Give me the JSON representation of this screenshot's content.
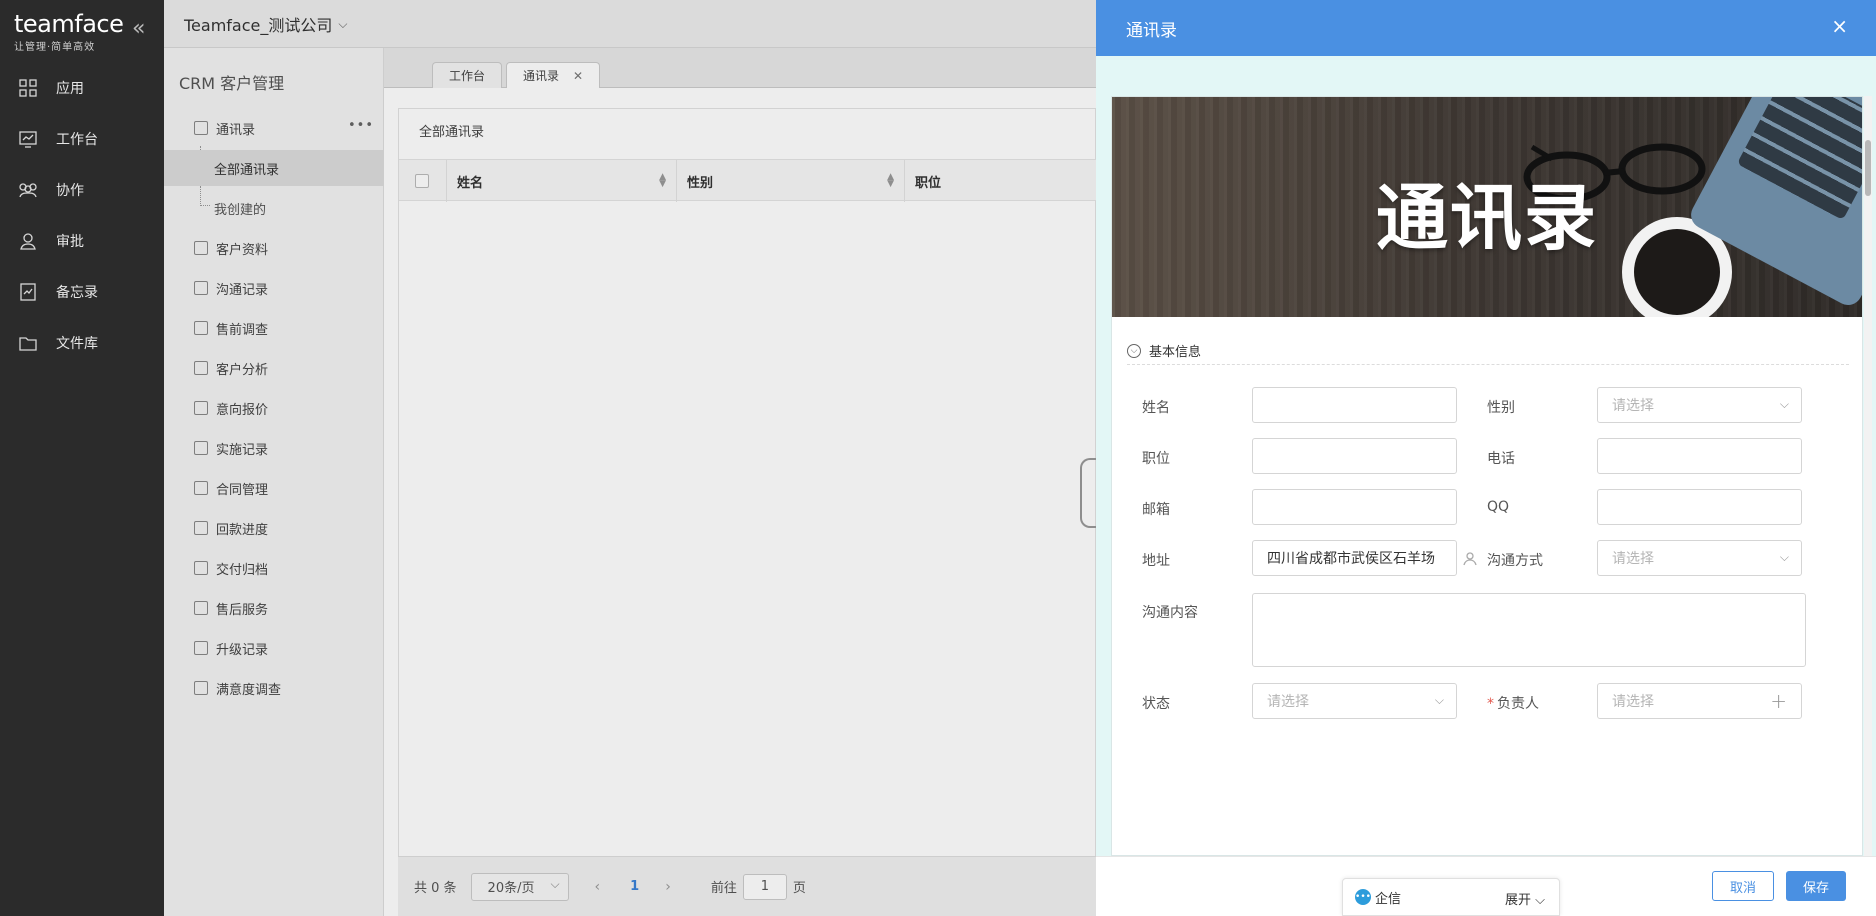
{
  "logo": {
    "brand": "teamface",
    "slogan": "让管理·简单高效"
  },
  "left_nav": {
    "items": [
      {
        "label": "应用",
        "icon": "apps-icon"
      },
      {
        "label": "工作台",
        "icon": "workbench-icon"
      },
      {
        "label": "协作",
        "icon": "collab-icon"
      },
      {
        "label": "审批",
        "icon": "approval-icon"
      },
      {
        "label": "备忘录",
        "icon": "memo-icon"
      },
      {
        "label": "文件库",
        "icon": "folder-icon"
      }
    ]
  },
  "header": {
    "company": "Teamface_测试公司"
  },
  "sidebar": {
    "title": "CRM 客户管理",
    "group": "通讯录",
    "subitems": [
      "全部通讯录",
      "我创建的"
    ],
    "items": [
      "客户资料",
      "沟通记录",
      "售前调查",
      "客户分析",
      "意向报价",
      "实施记录",
      "合同管理",
      "回款进度",
      "交付归档",
      "售后服务",
      "升级记录",
      "满意度调查"
    ]
  },
  "tabs": [
    {
      "label": "工作台"
    },
    {
      "label": "通讯录"
    }
  ],
  "list": {
    "heading": "全部通讯录",
    "columns": [
      "姓名",
      "性别",
      "职位"
    ]
  },
  "pager": {
    "total": "共 0 条",
    "page_size": "20条/页",
    "current": "1",
    "goto_label": "前往",
    "goto_value": "1",
    "page_suffix": "页"
  },
  "drawer": {
    "title": "通讯录",
    "close": "×",
    "banner_title": "通讯录",
    "section": "基本信息",
    "fields": {
      "name_label": "姓名",
      "gender_label": "性别",
      "gender_placeholder": "请选择",
      "position_label": "职位",
      "phone_label": "电话",
      "email_label": "邮箱",
      "qq_label": "QQ",
      "address_label": "地址",
      "address_value": "四川省成都市武侯区石羊场",
      "contact_method_label": "沟通方式",
      "contact_method_placeholder": "请选择",
      "content_label": "沟通内容",
      "status_label": "状态",
      "status_placeholder": "请选择",
      "owner_required": "*",
      "owner_label": "负责人",
      "owner_placeholder": "请选择"
    },
    "cancel": "取消",
    "save": "保存"
  },
  "qixin": {
    "label": "企信",
    "expand": "展开"
  },
  "colors": {
    "primary": "#4a90e2",
    "nav_bg": "#2b2b2b",
    "drawer_bg": "#e3f7f6"
  }
}
